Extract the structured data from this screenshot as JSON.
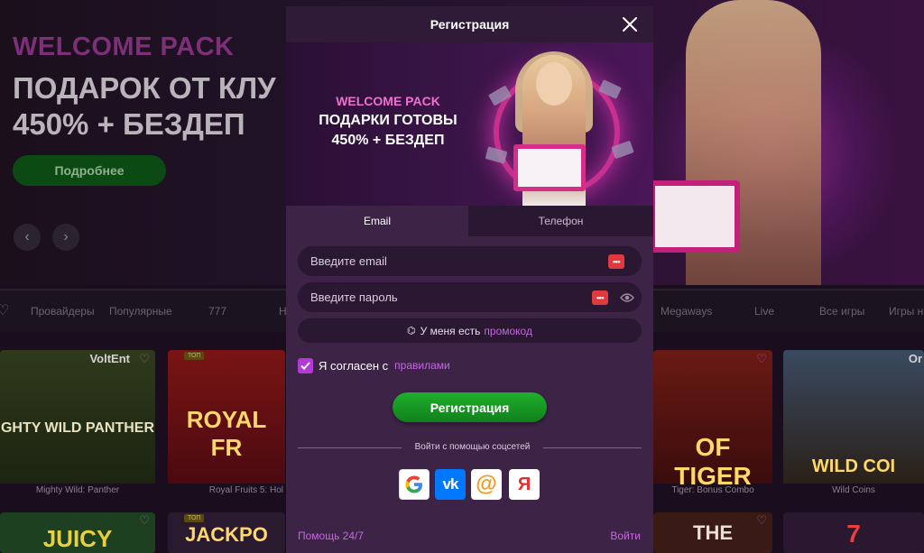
{
  "background": {
    "hero": {
      "kicker": "WELCOME PACK",
      "title_line1": "ПОДАРОК ОТ КЛУ",
      "title_line2": "450% + БЕЗДЕП",
      "details_button": "Подробнее",
      "prev": "‹",
      "next": "›"
    },
    "categories": [
      "Провайдеры",
      "Популярные",
      "777",
      "Н",
      "Megaways",
      "Live",
      "Все игры",
      "Игры н"
    ],
    "games_row1": [
      {
        "name": "Mighty Wild: Panther",
        "brand": "VoltEnt",
        "art": "GHTY WILD PANTHER"
      },
      {
        "name": "Royal Fruits 5: Hol",
        "badge": "ТОП",
        "art": "ROYAL FR"
      },
      {
        "name": "Tiger: Bonus Combo",
        "art": "OF TIGER"
      },
      {
        "name": "Wild Coins",
        "brand": "Or",
        "art": "WILD COI"
      }
    ],
    "games_row2": [
      {
        "badge": "",
        "art": "JUICY"
      },
      {
        "badge": "ТОП",
        "art": "JACKPO"
      },
      {
        "art": "THE"
      },
      {
        "art": "7"
      }
    ]
  },
  "modal": {
    "title": "Регистрация",
    "banner": {
      "kicker": "WELCOME PACK",
      "line1": "ПОДАРКИ ГОТОВЫ",
      "line2": "450% + БЕЗДЕП"
    },
    "tabs": {
      "email": "Email",
      "phone": "Телефон"
    },
    "email": {
      "placeholder": "Введите email"
    },
    "password": {
      "placeholder": "Введите пароль"
    },
    "promo": {
      "text": "У меня есть",
      "link": "промокод",
      "icon": "⌬"
    },
    "agree": {
      "text": "Я согласен с",
      "link": "правилами",
      "checked": true
    },
    "submit": "Регистрация",
    "social_label": "Войти с помощью соцсетей",
    "social": {
      "vk": "vk",
      "mail": "@",
      "ya": "Я"
    },
    "footer": {
      "help": "Помощь 24/7",
      "login": "Войти"
    }
  },
  "colors": {
    "accent_link": "#c667e0",
    "button_green": "#1fb02c",
    "modal_bg": "#3d2346",
    "checkbox": "#b43ad6"
  }
}
